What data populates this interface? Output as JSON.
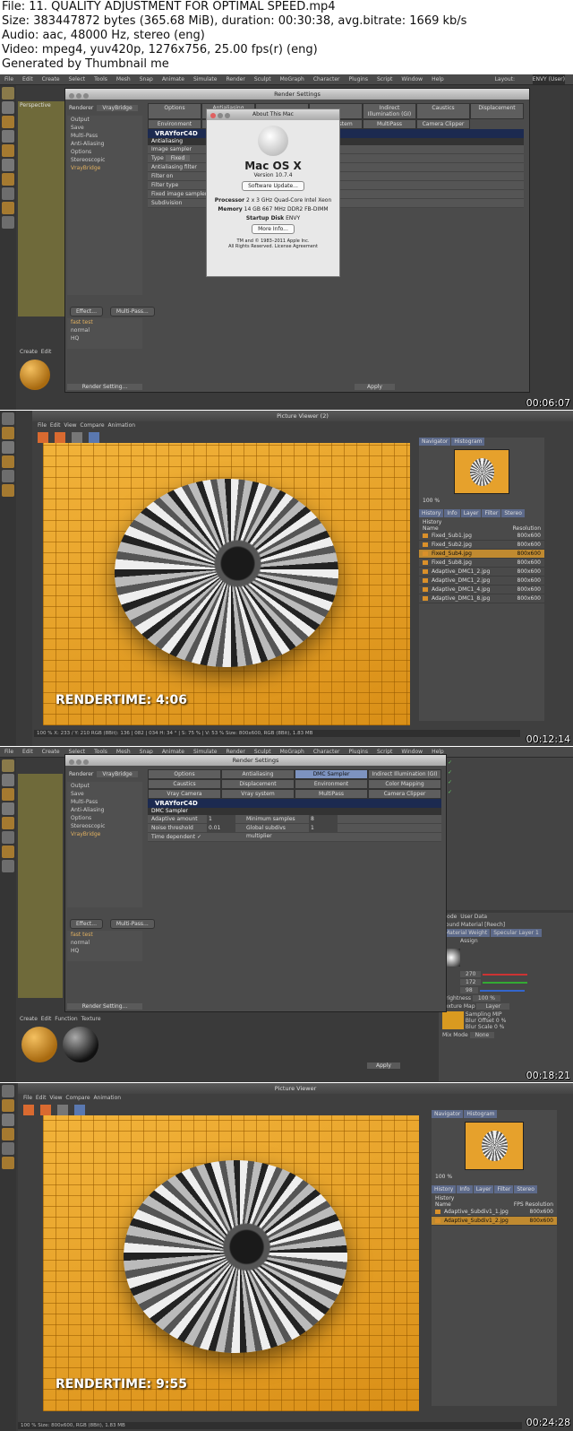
{
  "header": {
    "file_line": "File: 11. QUALITY ADJUSTMENT FOR OPTIMAL SPEED.mp4",
    "size_line": "Size: 383447872 bytes (365.68 MiB), duration: 00:30:38, avg.bitrate: 1669 kb/s",
    "audio_line": "Audio: aac, 48000 Hz, stereo (eng)",
    "video_line": "Video: mpeg4, yuv420p, 1276x756, 25.00 fps(r) (eng)",
    "generator_line": "Generated by Thumbnail me"
  },
  "frame1": {
    "timestamp": "00:06:07",
    "menu": [
      "File",
      "Edit",
      "Create",
      "Select",
      "Tools",
      "Mesh",
      "Snap",
      "Animate",
      "Simulate",
      "Render",
      "Sculpt",
      "MoGraph",
      "Character",
      "Plugins",
      "Script",
      "Window",
      "Help"
    ],
    "layout_label": "Layout:",
    "layout_value": "ENVY (User)",
    "viewport_label": "Perspective",
    "render_settings_title": "Render Settings",
    "renderer_label": "Renderer",
    "renderer_value": "VrayBridge",
    "sidebar_items": [
      "Output",
      "Save",
      "Multi-Pass",
      "Anti-Aliasing",
      "Options",
      "Stereoscopic",
      "VrayBridge"
    ],
    "tabs_row1": [
      "Options",
      "Antialiasing",
      "",
      "",
      "Indirect Illumination (GI)",
      "Caustics",
      "Displacement"
    ],
    "tabs_row2": [
      "Environment",
      "",
      "",
      "Vray system",
      "MultiPass",
      "Camera Clipper"
    ],
    "vray_logo": "VRAYforC4D",
    "section_antialiasing": "Antialiasing",
    "image_sampler": "Image sampler",
    "type_label": "Type",
    "type_value": "Fixed",
    "aa_filter": "Antialiasing filter",
    "filter_on": "Filter on",
    "filter_type": "Filter type",
    "fixed_sampler": "Fixed image sampler",
    "subdivision": "Subdivision",
    "effect_btn": "Effect...",
    "multipass_btn": "Multi-Pass...",
    "presets": [
      "fast test",
      "normal",
      "HQ"
    ],
    "render_setting_btn": "Render Setting...",
    "about_title": "About This Mac",
    "os_name": "Mac OS X",
    "os_version": "Version 10.7.4",
    "software_update": "Software Update...",
    "processor_label": "Processor",
    "processor_value": "2 x 3 GHz Quad-Core Intel Xeon",
    "memory_label": "Memory",
    "memory_value": "14 GB 667 MHz DDR2 FB-DIMM",
    "startup_label": "Startup Disk",
    "startup_value": "ENVY",
    "more_info": "More Info...",
    "copyright1": "TM and © 1983–2011 Apple Inc.",
    "copyright2": "All Rights Reserved.  License Agreement",
    "apply_btn": "Apply",
    "mat_menu": [
      "Create",
      "Edit"
    ]
  },
  "frame2": {
    "timestamp": "00:12:14",
    "title": "Picture Viewer (2)",
    "menu": [
      "File",
      "Edit",
      "View",
      "Compare",
      "Animation"
    ],
    "render_time": "RENDERTIME: 4:06",
    "nav_tabs": [
      "Navigator",
      "Histogram"
    ],
    "zoom": "100 %",
    "panel_tabs": [
      "History",
      "Info",
      "Layer",
      "Filter",
      "Stereo"
    ],
    "history_label": "History",
    "col_name": "Name",
    "col_res": "Resolution",
    "history": [
      {
        "name": "Fixed_Sub1.jpg",
        "res": "800x600"
      },
      {
        "name": "Fixed_Sub2.jpg",
        "res": "800x600"
      },
      {
        "name": "Fixed_Sub4.jpg",
        "res": "800x600"
      },
      {
        "name": "Fixed_Sub8.jpg",
        "res": "800x600"
      },
      {
        "name": "Adaptive_DMC1_2.jpg",
        "res": "800x600"
      },
      {
        "name": "Adaptive_DMC1_2.jpg",
        "res": "800x600"
      },
      {
        "name": "Adaptive_DMC1_4.jpg",
        "res": "800x600"
      },
      {
        "name": "Adaptive_DMC1_8.jpg",
        "res": "800x600"
      }
    ],
    "status": "100 %   X: 233 / Y: 210   RGB (8Bit): 136 | 082 | 034   H: 34 ° | S: 75 % | V: 53 %   Size: 800x600, RGB (8Bit), 1.83 MB"
  },
  "frame3": {
    "timestamp": "00:18:21",
    "render_settings_title": "Render Settings",
    "renderer_label": "Renderer",
    "renderer_value": "VrayBridge",
    "sidebar_items": [
      "Output",
      "Save",
      "Multi-Pass",
      "Anti-Aliasing",
      "Options",
      "Stereoscopic",
      "VrayBridge"
    ],
    "tabs_row1": [
      "Options",
      "Antialiasing",
      "DMC Sampler",
      "Indirect Illumination (GI)"
    ],
    "tabs_row2": [
      "Caustics",
      "Displacement",
      "Environment",
      "Color Mapping"
    ],
    "tabs_row3": [
      "Vray Camera",
      "Vray system",
      "MultiPass",
      "Camera Clipper"
    ],
    "vray_logo": "VRAYforC4D",
    "section": "DMC Sampler",
    "adaptive_amount": "Adaptive amount",
    "adaptive_value": "1",
    "min_samples": "Minimum samples",
    "min_samples_value": "8",
    "noise_threshold": "Noise threshold",
    "noise_value": "0.01",
    "global_subdivs": "Global subdivs multiplier",
    "global_value": "1",
    "time_dependent": "Time dependent",
    "effect_btn": "Effect...",
    "multipass_btn": "Multi-Pass...",
    "presets": [
      "fast test",
      "normal",
      "HQ"
    ],
    "render_setting_btn": "Render Setting...",
    "mat_menu": [
      "Create",
      "Edit",
      "Function",
      "Texture"
    ],
    "attr_mode": "Mode",
    "attr_userdata": "User Data",
    "attr_material": "Sound Material [Reech]",
    "attr_tabs": [
      "Material Weight",
      "Specular Layer 1"
    ],
    "assign": "Assign",
    "val1": "270",
    "val2": "172",
    "val3": "98",
    "brightness": "Brightness",
    "brightness_val": "100 %",
    "texture_map": "Texture Map",
    "layer": "Layer",
    "sampling": "Sampling",
    "sampling_val": "MIP",
    "blur_offset": "Blur Offset",
    "blur_offset_val": "0 %",
    "blur_scale": "Blur Scale",
    "blur_scale_val": "0 %",
    "mix_mode": "Mix Mode",
    "mix_mode_val": "None",
    "apply_btn": "Apply"
  },
  "frame4": {
    "timestamp": "00:24:28",
    "title": "Picture Viewer",
    "menu": [
      "File",
      "Edit",
      "View",
      "Compare",
      "Animation"
    ],
    "render_time": "RENDERTIME: 9:55",
    "nav_tabs": [
      "Navigator",
      "Histogram"
    ],
    "zoom": "100 %",
    "panel_tabs": [
      "History",
      "Info",
      "Layer",
      "Filter",
      "Stereo"
    ],
    "history_label": "History",
    "col_name": "Name",
    "col_fps": "FPS",
    "col_res": "Resolution",
    "history": [
      {
        "name": "Adaptive_Subdiv1_1.jpg",
        "res": "800x600"
      },
      {
        "name": "Adaptive_Subdiv1_2.jpg",
        "res": "800x600"
      }
    ],
    "status": "100 %   Size: 800x600, RGB (8Bit), 1.83 MB"
  },
  "colors": {
    "accent_blue": "#1c2a50",
    "render_orange": "#e6a12c",
    "ui_dark": "#3a3a3a"
  }
}
